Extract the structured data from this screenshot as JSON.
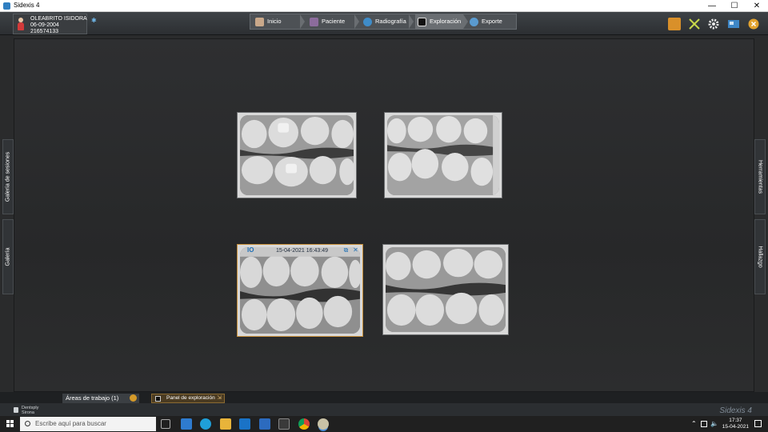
{
  "window": {
    "title": "Sidexis 4",
    "minimize": "—",
    "maximize": "☐",
    "close": "✕"
  },
  "patient": {
    "name": "OLEABRITO ISIDORA",
    "dob": "06-09-2004",
    "id": "216574133"
  },
  "nav": {
    "items": [
      {
        "label": "Inicio"
      },
      {
        "label": "Paciente"
      },
      {
        "label": "Radiografía"
      },
      {
        "label": "Exploración"
      },
      {
        "label": "Exporte"
      }
    ],
    "active": "Exploración"
  },
  "toolbar_icons": [
    "report-icon",
    "tools-icon",
    "settings-gear-icon",
    "window-layout-icon",
    "close-session-icon"
  ],
  "side_tabs": {
    "left": [
      "Galería de sesiones",
      "Galería"
    ],
    "right": [
      "Herramientas",
      "Hallazgo"
    ]
  },
  "images": [
    {
      "label": "bitewing-1"
    },
    {
      "label": "bitewing-2"
    },
    {
      "label": "bitewing-3",
      "overlay_date": "15-04-2021 16:43:49",
      "io_badge": "IO",
      "selected": true
    },
    {
      "label": "bitewing-4"
    }
  ],
  "bottom": {
    "workspaces_label": "Áreas de trabajo (1)",
    "exploration_panel_label": "Panel de exploración",
    "brand_line1": "Dentsply",
    "brand_line2": "Sirona",
    "product": "Sidexis 4"
  },
  "taskbar": {
    "search_placeholder": "Escribe aquí para buscar",
    "time": "17:37",
    "date": "15-04-2021",
    "tray_up": "⌃",
    "tray_icons": "🔈"
  },
  "colors": {
    "accent": "#c8903a",
    "background": "#2a2b2c",
    "brand_blue": "#1e6fb5"
  }
}
